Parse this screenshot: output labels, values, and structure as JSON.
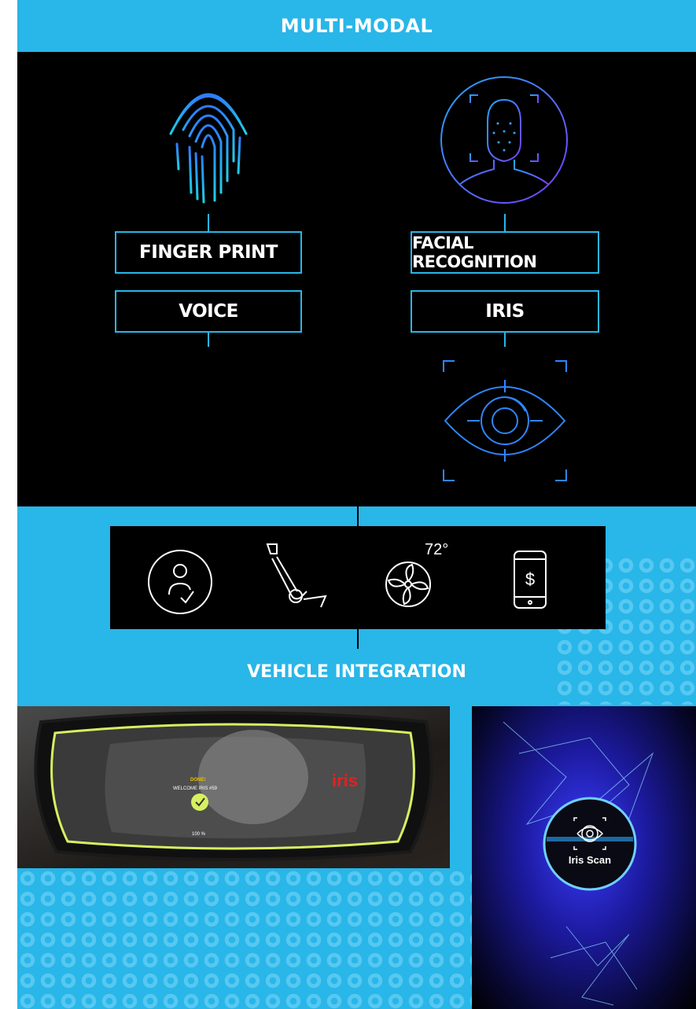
{
  "header": {
    "title": "MULTI-MODAL"
  },
  "modalities": {
    "fingerprint": "FINGER PRINT",
    "facial": "FACIAL RECOGNITION",
    "voice": "VOICE",
    "iris": "IRIS"
  },
  "features": {
    "temperature": "72°",
    "icons": [
      "user-check-icon",
      "seat-icon",
      "climate-fan-icon",
      "phone-payment-icon"
    ]
  },
  "integration": {
    "title": "VEHICLE INTEGRATION"
  },
  "mirror": {
    "status": "DONE!",
    "welcome": "WELCOME IRIS #59",
    "progress": "100 %",
    "brand": "iris"
  },
  "phone": {
    "scan_label": "Iris Scan"
  },
  "colors": {
    "accent": "#29b6e8",
    "panel": "#000000",
    "text": "#ffffff"
  }
}
